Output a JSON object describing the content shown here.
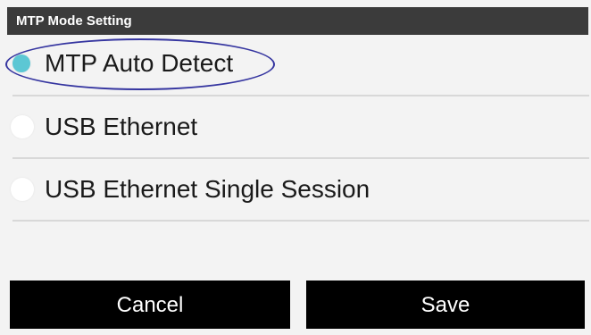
{
  "dialog": {
    "title": "MTP Mode Setting",
    "options": [
      {
        "label": "MTP Auto Detect",
        "selected": true
      },
      {
        "label": "USB Ethernet",
        "selected": false
      },
      {
        "label": "USB Ethernet Single Session",
        "selected": false
      }
    ],
    "buttons": {
      "cancel_label": "Cancel",
      "save_label": "Save"
    }
  },
  "colors": {
    "title_bar": "#3b3b3b",
    "selected_radio": "#5cc7d4",
    "button_bg": "#000000",
    "annotation_ellipse": "#3535a0"
  }
}
